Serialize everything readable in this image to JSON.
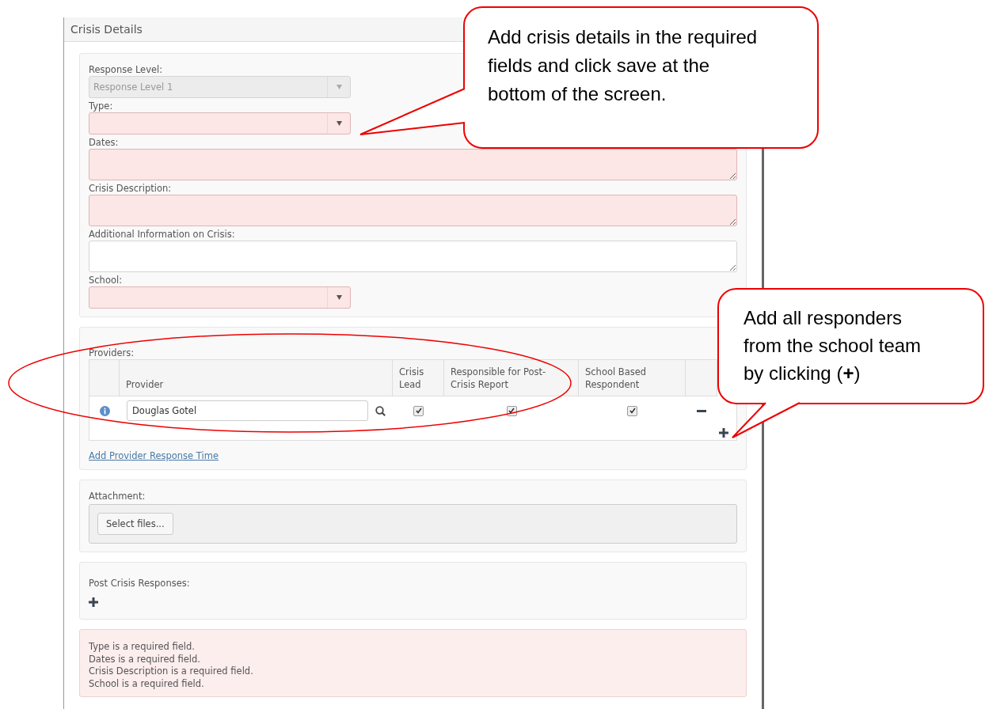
{
  "panel": {
    "title": "Crisis Details"
  },
  "fields": [
    {
      "label": "Response Level:",
      "kind": "select",
      "value": "Response Level 1",
      "disabled": true,
      "required": false
    },
    {
      "label": "Type:",
      "kind": "select",
      "disabled": false,
      "required": true
    },
    {
      "label": "Dates:",
      "kind": "textarea",
      "disabled": false,
      "required": true
    },
    {
      "label": "Crisis Description:",
      "kind": "textarea",
      "disabled": false,
      "required": true
    },
    {
      "label": "Additional Information on Crisis:",
      "kind": "textarea",
      "disabled": false,
      "required": false
    },
    {
      "label": "School:",
      "kind": "select",
      "disabled": false,
      "required": true
    }
  ],
  "providers": {
    "label": "Providers:",
    "columns": [
      "Provider",
      "Crisis Lead",
      "Responsible for Post-Crisis Report",
      "School Based Respondent"
    ],
    "rows": [
      {
        "provider": "Douglas Gotel",
        "crisis_lead": true,
        "responsible": true,
        "school_based": true
      }
    ],
    "link": "Add Provider Response Time"
  },
  "attachment": {
    "label": "Attachment:",
    "button": "Select files..."
  },
  "post_crisis": {
    "label": "Post Crisis Responses:"
  },
  "errors": [
    "Type is a required field.",
    "Dates is a required field.",
    "Crisis Description is a required field.",
    "School is a required field."
  ],
  "callouts": [
    {
      "text": "Add crisis details in the required fields and click save at the bottom of the screen."
    },
    {
      "text": "Add all responders from the school team by clicking (**+**)"
    }
  ]
}
